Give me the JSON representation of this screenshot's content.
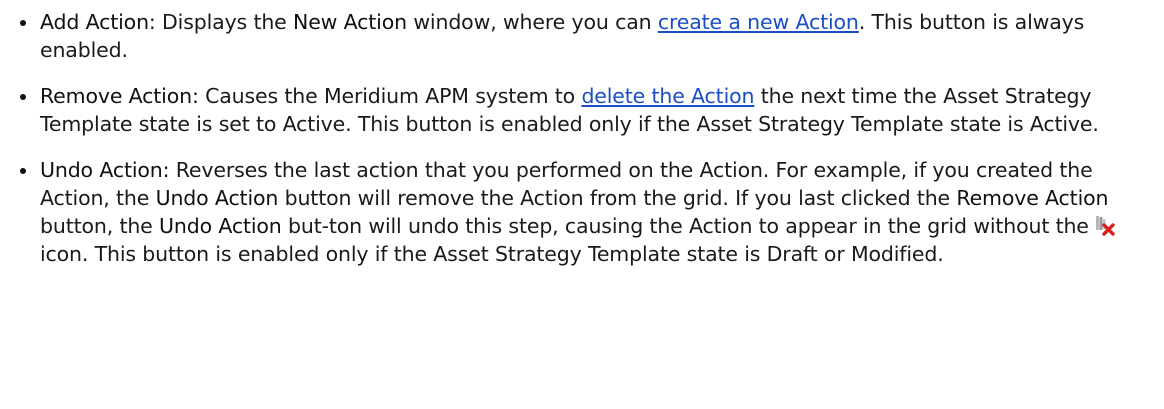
{
  "items": [
    {
      "term": "Add Action:",
      "text_1": " Displays the ",
      "bold_1": "New Action",
      "text_2": " window, where you can ",
      "link": "create a new Action",
      "text_3": ". This button is always enabled."
    },
    {
      "term": "Remove Action:",
      "text_1": " Causes the Meridium APM system to ",
      "link": "delete the Action",
      "text_2": " the next time the Asset Strategy Template state is set to Active. This button is enabled only if the Asset Strategy Template state is Active."
    },
    {
      "term": "Undo Action:",
      "text_1": " Reverses the last action that you performed on the Action. For example, if you created the Action, the ",
      "bold_1": "Undo Action",
      "text_2": " button will remove the Action from the grid. If you last clicked the ",
      "bold_2": "Remove Action",
      "text_3": " button, the ",
      "bold_3": "Undo Action",
      "text_4": " but-ton will undo this step, causing the Action to appear in the grid without the",
      "icon": "remove-action-icon",
      "text_5": "icon. This button is enabled only if the Asset Strategy Template state is Draft or Modified."
    }
  ]
}
